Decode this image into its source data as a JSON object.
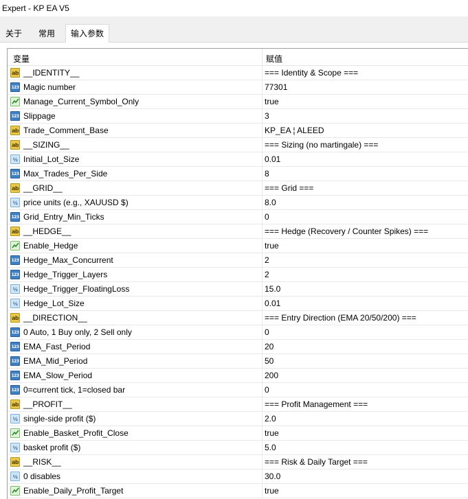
{
  "window": {
    "title": "Expert - KP EA V5"
  },
  "tabs": [
    {
      "label": "关于"
    },
    {
      "label": "常用"
    },
    {
      "label": "输入参数"
    }
  ],
  "table": {
    "headers": {
      "variable": "变量",
      "value": "赋值"
    },
    "rows": [
      {
        "type": "ab",
        "icon": "string-icon",
        "name": "__IDENTITY__",
        "value": "=== Identity & Scope ==="
      },
      {
        "type": "123",
        "icon": "integer-icon",
        "name": "Magic number",
        "value": "77301"
      },
      {
        "type": "bool",
        "icon": "bool-icon",
        "name": "Manage_Current_Symbol_Only",
        "value": "true"
      },
      {
        "type": "123",
        "icon": "integer-icon",
        "name": "Slippage",
        "value": "3"
      },
      {
        "type": "ab",
        "icon": "string-icon",
        "name": "Trade_Comment_Base",
        "value": "KP_EA  ¦ ALEED"
      },
      {
        "type": "ab",
        "icon": "string-icon",
        "name": "__SIZING__",
        "value": "=== Sizing (no martingale) ==="
      },
      {
        "type": "v2",
        "icon": "double-icon",
        "name": "Initial_Lot_Size",
        "value": "0.01"
      },
      {
        "type": "123",
        "icon": "integer-icon",
        "name": "Max_Trades_Per_Side",
        "value": "8"
      },
      {
        "type": "ab",
        "icon": "string-icon",
        "name": "__GRID__",
        "value": "=== Grid ==="
      },
      {
        "type": "v2",
        "icon": "double-icon",
        "name": "price units (e.g., XAUUSD $)",
        "value": "8.0"
      },
      {
        "type": "123",
        "icon": "integer-icon",
        "name": "Grid_Entry_Min_Ticks",
        "value": "0"
      },
      {
        "type": "ab",
        "icon": "string-icon",
        "name": "__HEDGE__",
        "value": "=== Hedge (Recovery / Counter Spikes) ==="
      },
      {
        "type": "bool",
        "icon": "bool-icon",
        "name": "Enable_Hedge",
        "value": "true"
      },
      {
        "type": "123",
        "icon": "integer-icon",
        "name": "Hedge_Max_Concurrent",
        "value": "2"
      },
      {
        "type": "123",
        "icon": "integer-icon",
        "name": "Hedge_Trigger_Layers",
        "value": "2"
      },
      {
        "type": "v2",
        "icon": "double-icon",
        "name": "Hedge_Trigger_FloatingLoss",
        "value": "15.0"
      },
      {
        "type": "v2",
        "icon": "double-icon",
        "name": "Hedge_Lot_Size",
        "value": "0.01"
      },
      {
        "type": "ab",
        "icon": "string-icon",
        "name": "__DIRECTION__",
        "value": "=== Entry Direction (EMA 20/50/200) ==="
      },
      {
        "type": "123",
        "icon": "integer-icon",
        "name": "0 Auto, 1 Buy only, 2 Sell only",
        "value": "0"
      },
      {
        "type": "123",
        "icon": "integer-icon",
        "name": "EMA_Fast_Period",
        "value": "20"
      },
      {
        "type": "123",
        "icon": "integer-icon",
        "name": "EMA_Mid_Period",
        "value": "50"
      },
      {
        "type": "123",
        "icon": "integer-icon",
        "name": "EMA_Slow_Period",
        "value": "200"
      },
      {
        "type": "123",
        "icon": "integer-icon",
        "name": "0=current tick, 1=closed bar",
        "value": "0"
      },
      {
        "type": "ab",
        "icon": "string-icon",
        "name": "__PROFIT__",
        "value": "=== Profit Management ==="
      },
      {
        "type": "v2",
        "icon": "double-icon",
        "name": "single-side profit ($)",
        "value": "2.0"
      },
      {
        "type": "bool",
        "icon": "bool-icon",
        "name": "Enable_Basket_Profit_Close",
        "value": "true"
      },
      {
        "type": "v2",
        "icon": "double-icon",
        "name": "basket profit ($)",
        "value": "5.0"
      },
      {
        "type": "ab",
        "icon": "string-icon",
        "name": "__RISK__",
        "value": "=== Risk & Daily Target ==="
      },
      {
        "type": "v2",
        "icon": "double-icon",
        "name": "0 disables",
        "value": "30.0"
      },
      {
        "type": "bool",
        "icon": "bool-icon",
        "name": "Enable_Daily_Profit_Target",
        "value": "true"
      }
    ]
  },
  "icon_labels": {
    "ab": "ab",
    "123": "123",
    "v2": "½"
  }
}
